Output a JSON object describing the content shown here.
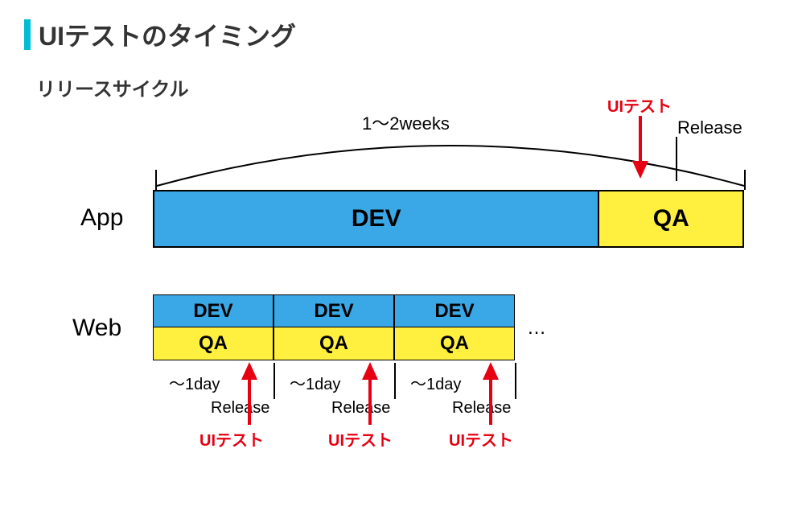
{
  "title": "UIテストのタイミング",
  "subtitle": "リリースサイクル",
  "arcLabel": "1～2weeks",
  "uiTestLabel": "UIテスト",
  "releaseLabel": "Release",
  "app": {
    "label": "App",
    "dev": "DEV",
    "qa": "QA"
  },
  "web": {
    "label": "Web",
    "dev": "DEV",
    "qa": "QA",
    "dayLabel": "～1day",
    "ellipsis": "…"
  }
}
